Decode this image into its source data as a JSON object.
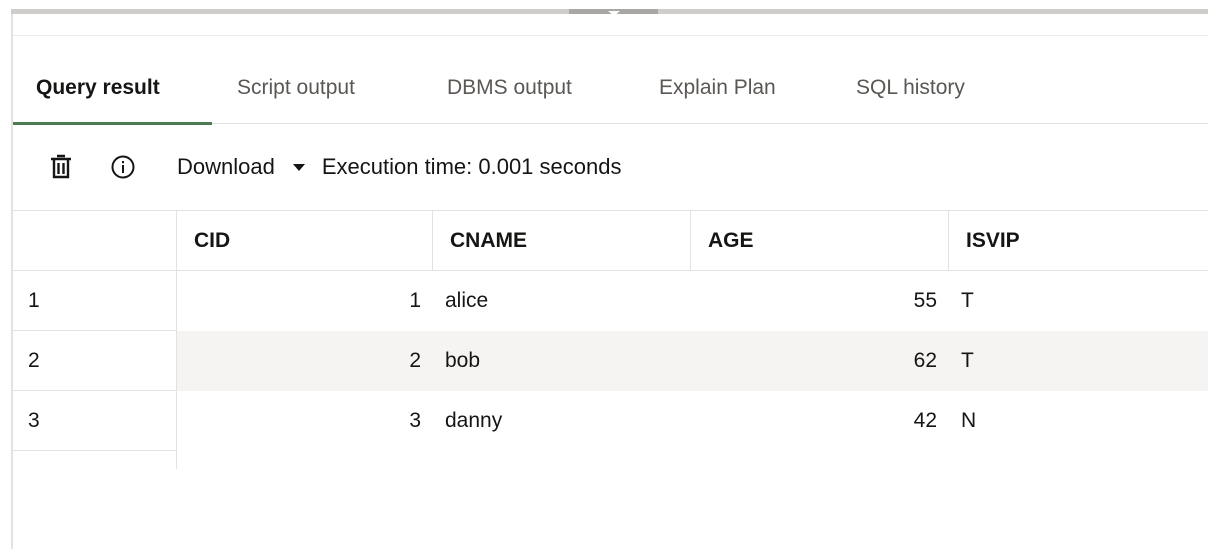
{
  "tabs": [
    {
      "label": "Query result",
      "active": true
    },
    {
      "label": "Script output",
      "active": false
    },
    {
      "label": "DBMS output",
      "active": false
    },
    {
      "label": "Explain Plan",
      "active": false
    },
    {
      "label": "SQL history",
      "active": false
    }
  ],
  "toolbar": {
    "delete_icon": "trash-icon",
    "info_icon": "info-icon",
    "download_label": "Download",
    "execution_time": "Execution time: 0.001 seconds"
  },
  "grid": {
    "columns": [
      "CID",
      "CNAME",
      "AGE",
      "ISVIP"
    ],
    "rows": [
      {
        "num": "1",
        "cid": "1",
        "cname": "alice",
        "age": "55",
        "isvip": "T"
      },
      {
        "num": "2",
        "cid": "2",
        "cname": "bob",
        "age": "62",
        "isvip": "T"
      },
      {
        "num": "3",
        "cid": "3",
        "cname": "danny",
        "age": "42",
        "isvip": "N"
      }
    ]
  },
  "colors": {
    "active_tab_underline": "#4b7a53",
    "alt_row": "#f5f4f2",
    "splitter": "#cfcdca"
  }
}
